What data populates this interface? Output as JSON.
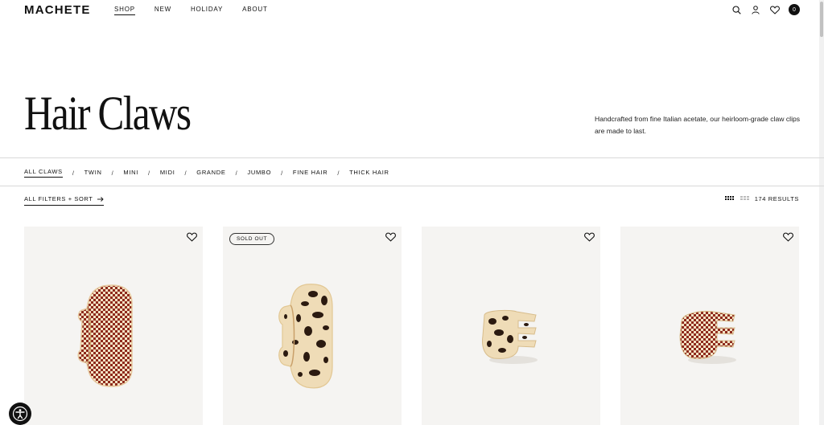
{
  "header": {
    "logo": "MACHETE",
    "nav": [
      "SHOP",
      "NEW",
      "HOLIDAY",
      "ABOUT"
    ],
    "cart_count": "0",
    "icons": [
      "search-icon",
      "account-icon",
      "heart-icon",
      "cart-badge"
    ]
  },
  "hero": {
    "title": "Hair Claws",
    "subtitle": "Handcrafted from fine Italian acetate, our heirloom-grade claw clips are made to last."
  },
  "categories": [
    "ALL CLAWS",
    "TWIN",
    "MINI",
    "MIDI",
    "GRANDE",
    "JUMBO",
    "FINE HAIR",
    "THICK HAIR"
  ],
  "filters": {
    "label": "ALL FILTERS + SORT",
    "results": "174 RESULTS"
  },
  "products": [
    {
      "badge": "",
      "pattern": "checker-red"
    },
    {
      "badge": "SOLD OUT",
      "pattern": "tortoise"
    },
    {
      "badge": "",
      "pattern": "tortoise-mini"
    },
    {
      "badge": "",
      "pattern": "checker-red-mini"
    }
  ],
  "colors": {
    "text": "#111111",
    "card_bg": "#f5f4f2",
    "checker_red": "#8e2a1c",
    "checker_cream": "#f3e2c4",
    "tortoise_base": "#efdcb7",
    "tortoise_spot": "#2b1a10"
  }
}
